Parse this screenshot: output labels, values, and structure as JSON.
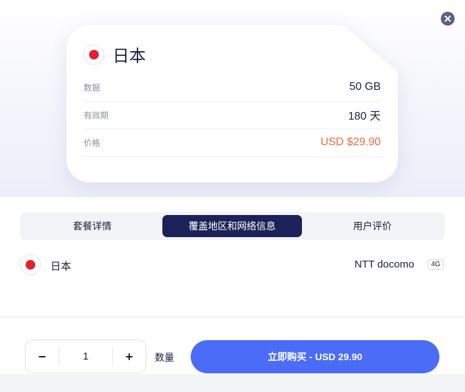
{
  "plan": {
    "country": "日本",
    "details": [
      {
        "label": "数据",
        "value": "50 GB"
      },
      {
        "label": "有效期",
        "value": "180 天"
      },
      {
        "label": "价格",
        "value": "USD $29.90"
      }
    ]
  },
  "tabs": [
    {
      "label": "套餐详情",
      "active": false
    },
    {
      "label": "覆盖地区和网络信息",
      "active": true
    },
    {
      "label": "用户评价",
      "active": false
    }
  ],
  "coverage": {
    "country": "日本",
    "operator": "NTT docomo",
    "network": "4G"
  },
  "purchase": {
    "minus": "−",
    "quantity": "1",
    "plus": "+",
    "quantity_label": "数量",
    "buy_label": "立即购买 - USD 29.90"
  },
  "colors": {
    "accent": "#4a6cf7",
    "active_tab": "#1c2159",
    "price": "#f06a3a",
    "flag_red": "#e32032"
  },
  "icons": {
    "close": "close-icon",
    "flag": "japan-flag-icon"
  }
}
